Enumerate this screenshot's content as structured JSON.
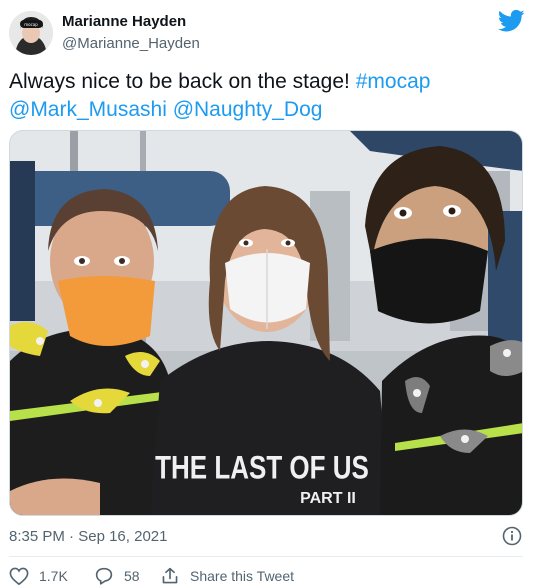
{
  "author": {
    "display_name": "Marianne Hayden",
    "handle": "@Marianne_Hayden",
    "avatar_icon": "avatar-photo"
  },
  "brand": {
    "icon": "twitter-bird-icon",
    "color": "#1d9bf0"
  },
  "tweet": {
    "text_plain": "Always nice to be back on the stage! ",
    "hashtag": "#mocap",
    "mention_1": "@Mark_Musashi",
    "mention_2": "@Naughty_Dog",
    "link_color": "#1d9bf0"
  },
  "photo": {
    "shirt_text_line1": "THE LAST OF US",
    "shirt_text_line2": "PART II"
  },
  "meta": {
    "time": "8:35 PM",
    "separator": " · ",
    "date": "Sep 16, 2021"
  },
  "actions": {
    "likes": "1.7K",
    "replies": "58",
    "share_label": "Share this Tweet"
  }
}
